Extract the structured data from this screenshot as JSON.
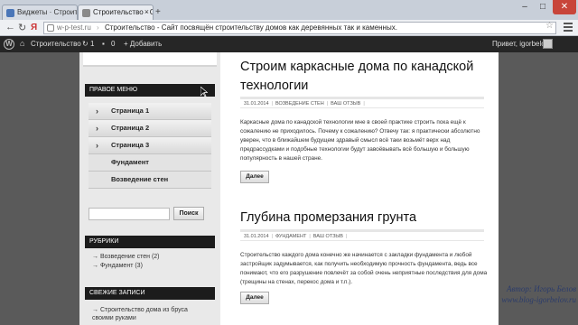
{
  "browser": {
    "tabs": [
      {
        "label": "Виджеты · Строител...",
        "active": false,
        "favicon_color": "#4a76b8"
      },
      {
        "label": "Строительство - Сайт...",
        "active": true,
        "favicon_color": "#8a8a8a"
      }
    ],
    "new_tab_symbol": "+",
    "back_symbol": "←",
    "reload_symbol": "↻",
    "yandex_symbol": "Я",
    "url_host": "w-p-test.ru",
    "url_title": "Строительство - Сайт посвящён строительству домов как деревянных так и каменных.",
    "window_controls": [
      "–",
      "□",
      "✕"
    ]
  },
  "adminbar": {
    "site_name": "Строительство",
    "updates_count": "1",
    "comments_count": "0",
    "add_label": "+ Добавить",
    "greeting": "Привет, igorbelov"
  },
  "sidebar": {
    "menu_title": "ПРАВОЕ МЕНЮ",
    "menu_items": [
      {
        "label": "Страница 1",
        "has_children": true
      },
      {
        "label": "Страница 2",
        "has_children": true
      },
      {
        "label": "Страница 3",
        "has_children": true
      },
      {
        "label": "Фундамент",
        "has_children": false
      },
      {
        "label": "Возведение стен",
        "has_children": false
      }
    ],
    "search_value": "",
    "search_button": "Поиск",
    "categories_title": "РУБРИКИ",
    "categories": [
      "Возведение стен (2)",
      "Фундамент (3)"
    ],
    "recent_title": "СВЕЖИЕ ЗАПИСИ",
    "recent_posts": [
      "Строительство дома из бруса своими руками"
    ]
  },
  "posts": [
    {
      "title": "Строим каркасные дома по канадской технологии",
      "date": "31.01.2014",
      "category": "ВОЗВЕДЕНИЕ СТЕН",
      "comments": "ВАШ ОТЗЫВ",
      "excerpt": "Каркасные дома по канадской технологии мне в своей практике строить пока ещё к сожалению не приходилось. Почему к сожалению? Отвечу так: я практически абсолютно уверен, что в ближайшем будущем здравый смысл всё таки возьмёт верх над предрассудками и подобные технологии будут завоёвывать всё большую и большую популярность в нашей стране.",
      "more": "Далее"
    },
    {
      "title": "Глубина промерзания грунта",
      "date": "31.01.2014",
      "category": "ФУНДАМЕНТ",
      "comments": "ВАШ ОТЗЫВ",
      "excerpt": "Строительство каждого дома конечно же начинается с закладки фундамента и любой застройщик задумывается, как получить необходимую прочность фундамента, ведь все понимают, что его разрушение повлечёт за собой очень неприятные последствия для дома (трещины на стенах, перекос дома и т.п.).",
      "more": "Далее"
    }
  ],
  "watermark": {
    "author": "Автор: Игорь Белов",
    "site": "www.blog-igorbelov.ru"
  }
}
